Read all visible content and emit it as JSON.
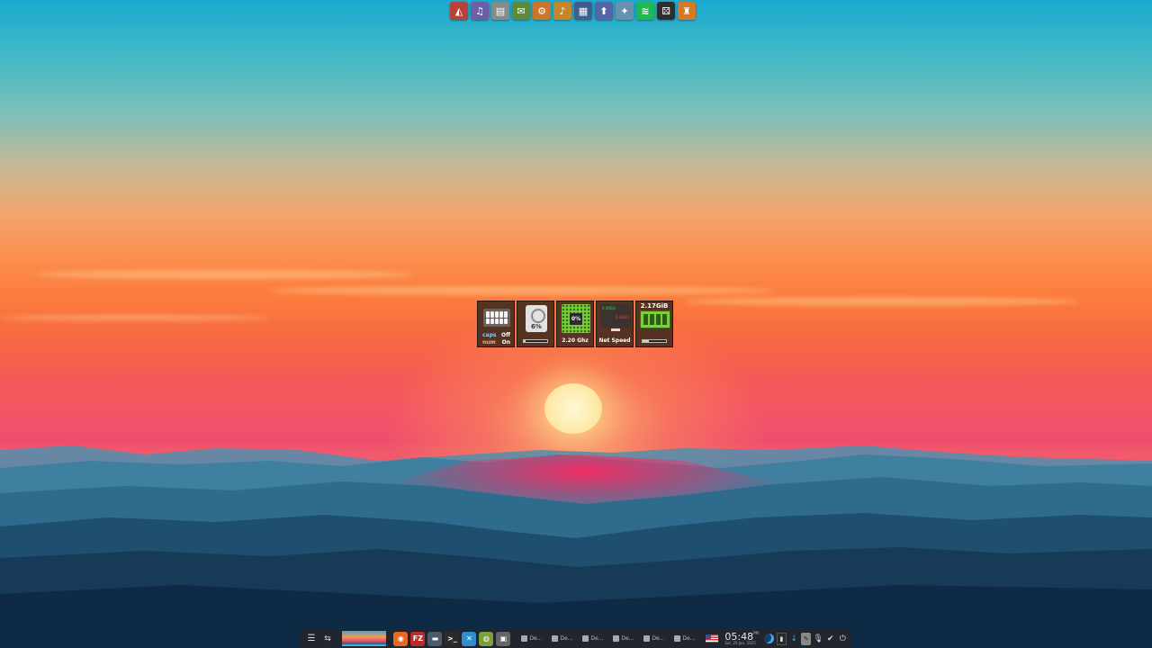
{
  "top_dock": {
    "apps": [
      {
        "name": "app-1",
        "glyph": "◭",
        "color": "#b8423a"
      },
      {
        "name": "app-2",
        "glyph": "♫",
        "color": "#6a5fa8"
      },
      {
        "name": "app-3",
        "glyph": "▤",
        "color": "#8a8a8a"
      },
      {
        "name": "app-4",
        "glyph": "✉",
        "color": "#5a8a3a"
      },
      {
        "name": "app-5",
        "glyph": "⚙",
        "color": "#c9782a"
      },
      {
        "name": "app-6",
        "glyph": "♪",
        "color": "#c4862a"
      },
      {
        "name": "app-7",
        "glyph": "▦",
        "color": "#3f5e8e"
      },
      {
        "name": "app-8",
        "glyph": "⬆",
        "color": "#5466a8"
      },
      {
        "name": "app-9",
        "glyph": "✦",
        "color": "#6a90b0"
      },
      {
        "name": "spotify",
        "glyph": "≋",
        "color": "#1db954"
      },
      {
        "name": "app-11",
        "glyph": "⚄",
        "color": "#2e2e2e"
      },
      {
        "name": "app-12",
        "glyph": "♜",
        "color": "#d27a2a"
      }
    ]
  },
  "widgets": {
    "keyboard": {
      "caps_label": "caps",
      "caps_state": "Off",
      "num_label": "num",
      "num_state": "On"
    },
    "disk": {
      "percent": "6%",
      "fill": 0.06
    },
    "cpu": {
      "load": "0%",
      "freq": "2.20 Ghz"
    },
    "net": {
      "label": "Net Speed",
      "up": "0.0KB/s",
      "down": "0.0KB/s"
    },
    "ram": {
      "used": "2.17GiB",
      "fill": 0.25
    }
  },
  "panel": {
    "menu_glyph": "☰",
    "apps": [
      {
        "name": "firefox",
        "glyph": "◉",
        "color": "#e66a1f"
      },
      {
        "name": "filezilla",
        "glyph": "FZ",
        "color": "#bf2a2a"
      },
      {
        "name": "app-3",
        "glyph": "▬",
        "color": "#4d5a6a"
      },
      {
        "name": "terminal",
        "glyph": ">_",
        "color": "#2b2b2b"
      },
      {
        "name": "app-5",
        "glyph": "✕",
        "color": "#2d8fcf"
      },
      {
        "name": "app-6",
        "glyph": "◍",
        "color": "#7aa03a"
      },
      {
        "name": "app-7",
        "glyph": "▣",
        "color": "#666"
      }
    ],
    "tasks": [
      "De...",
      "De...",
      "De...",
      "De...",
      "De...",
      "De..."
    ],
    "time": "05:48",
    "ampm": "PM",
    "date": "Sat, 25 Jan, 2025"
  }
}
